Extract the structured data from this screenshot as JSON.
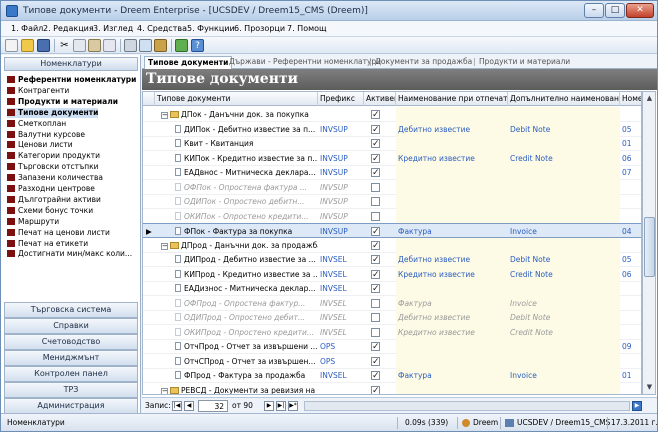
{
  "window": {
    "title": "Типове документи - Dreem Enterprise - [UCSDEV / Dreem15_CMS (Dreem)]"
  },
  "menu": [
    "1. Файл",
    "2. Редакция",
    "3. Изглед",
    "4. Средства",
    "5. Функции",
    "6. Прозорци",
    "7. Помощ"
  ],
  "sidebar": {
    "header": "Номенклатури",
    "items": [
      {
        "label": "Референтни номенклатури",
        "bold": true
      },
      {
        "label": "Контрагенти",
        "bold": false
      },
      {
        "label": "Продукти и материали",
        "bold": true
      },
      {
        "label": "Типове документи",
        "bold": true,
        "selected": true
      },
      {
        "label": "Сметкоплан",
        "bold": false
      },
      {
        "label": "Валутни курсове",
        "bold": false
      },
      {
        "label": "Ценови листи",
        "bold": false
      },
      {
        "label": "Категории продукти",
        "bold": false
      },
      {
        "label": "Търговски отстъпки",
        "bold": false
      },
      {
        "label": "Запазени количества",
        "bold": false
      },
      {
        "label": "Разходни центрове",
        "bold": false
      },
      {
        "label": "Дълготрайни активи",
        "bold": false
      },
      {
        "label": "Схеми бонус точки",
        "bold": false
      },
      {
        "label": "Маршрути",
        "bold": false
      },
      {
        "label": "Печат на ценови листи",
        "bold": false
      },
      {
        "label": "Печат на етикети",
        "bold": false
      },
      {
        "label": "Достигнати мин/макс коли...",
        "bold": false
      }
    ],
    "groups": [
      "Търговска система",
      "Справки",
      "Счетоводство",
      "Мениджмънт",
      "Контролен панел",
      "ТРЗ",
      "Администрация"
    ]
  },
  "tabs": [
    {
      "label": "Типове документи",
      "active": true
    },
    {
      "label": "Държави - Референтни номенклатури",
      "active": false
    },
    {
      "label": "Документи за продажба",
      "active": false
    },
    {
      "label": "Продукти и материали",
      "active": false
    }
  ],
  "page_title": "Типове документи",
  "grid": {
    "columns": [
      "Типове документи",
      "Префикс",
      "Активен",
      "Наименование при отпечат...",
      "Допълнително наименован...",
      "Номе"
    ],
    "rows": [
      {
        "level": 1,
        "type": "folder",
        "name": "ДПок - Данъчни док. за покупка",
        "prefix": "",
        "active": true,
        "print": "",
        "extra": "",
        "num": "",
        "dim": false
      },
      {
        "level": 2,
        "type": "doc",
        "name": "ДИПок - Дебитно известие за п...",
        "prefix": "INVSUP",
        "active": true,
        "print": "Дебитно известие",
        "extra": "Debit Note",
        "num": "05",
        "dim": false
      },
      {
        "level": 2,
        "type": "doc",
        "name": "Квит - Квитанция",
        "prefix": "",
        "active": true,
        "print": "",
        "extra": "",
        "num": "01",
        "dim": false
      },
      {
        "level": 2,
        "type": "doc",
        "name": "КИПок - Кредитно известие за п...",
        "prefix": "INVSUP",
        "active": true,
        "print": "Кредитно известие",
        "extra": "Credit Note",
        "num": "06",
        "dim": false
      },
      {
        "level": 2,
        "type": "doc",
        "name": "ЕАДвнос - Митническа деклара...",
        "prefix": "INVSUP",
        "active": true,
        "print": "",
        "extra": "",
        "num": "07",
        "dim": false
      },
      {
        "level": 2,
        "type": "doc",
        "name": "ОФПок - Опростена фактура ...",
        "prefix": "INVSUP",
        "active": false,
        "print": "",
        "extra": "",
        "num": "",
        "dim": true
      },
      {
        "level": 2,
        "type": "doc",
        "name": "ОДИПок - Опростено дебитн...",
        "prefix": "INVSUP",
        "active": false,
        "print": "",
        "extra": "",
        "num": "",
        "dim": true
      },
      {
        "level": 2,
        "type": "doc",
        "name": "ОКИПок - Опростено кредити...",
        "prefix": "INVSUP",
        "active": false,
        "print": "",
        "extra": "",
        "num": "",
        "dim": true
      },
      {
        "level": 2,
        "type": "doc",
        "name": "ФПок - Фактура за покупка",
        "prefix": "INVSUP",
        "active": true,
        "print": "Фактура",
        "extra": "Invoice",
        "num": "04",
        "dim": false,
        "selected": true
      },
      {
        "level": 1,
        "type": "folder",
        "name": "ДПрод - Данъчни док. за продажба",
        "prefix": "",
        "active": true,
        "print": "",
        "extra": "",
        "num": "",
        "dim": false
      },
      {
        "level": 2,
        "type": "doc",
        "name": "ДИПрод - Дебитно известие за ...",
        "prefix": "INVSEL",
        "active": true,
        "print": "Дебитно известие",
        "extra": "Debit Note",
        "num": "05",
        "dim": false
      },
      {
        "level": 2,
        "type": "doc",
        "name": "КИПрод - Кредитно известие за ...",
        "prefix": "INVSEL",
        "active": true,
        "print": "Кредитно известие",
        "extra": "Credit Note",
        "num": "06",
        "dim": false
      },
      {
        "level": 2,
        "type": "doc",
        "name": "ЕАДизнос - Митническа деклар...",
        "prefix": "INVSEL",
        "active": true,
        "print": "",
        "extra": "",
        "num": "",
        "dim": false
      },
      {
        "level": 2,
        "type": "doc",
        "name": "ОФПрод - Опростена фактур...",
        "prefix": "INVSEL",
        "active": false,
        "print": "Фактура",
        "extra": "Invoice",
        "num": "",
        "dim": true
      },
      {
        "level": 2,
        "type": "doc",
        "name": "ОДИПрод - Опростено дебит...",
        "prefix": "INVSEL",
        "active": false,
        "print": "Дебитно известие",
        "extra": "Debit Note",
        "num": "",
        "dim": true
      },
      {
        "level": 2,
        "type": "doc",
        "name": "ОКИПрод - Опростено кредити...",
        "prefix": "INVSEL",
        "active": false,
        "print": "Кредитно известие",
        "extra": "Credit Note",
        "num": "",
        "dim": true
      },
      {
        "level": 2,
        "type": "doc",
        "name": "ОтчПрод - Отчет за извършени ...",
        "prefix": "OPS",
        "active": true,
        "print": "",
        "extra": "",
        "num": "09",
        "dim": false
      },
      {
        "level": 2,
        "type": "doc",
        "name": "ОтчСПрод - Отчет за извършен...",
        "prefix": "OPS",
        "active": true,
        "print": "",
        "extra": "",
        "num": "",
        "dim": false
      },
      {
        "level": 2,
        "type": "doc",
        "name": "ФПрод - Фактура за продажба",
        "prefix": "INVSEL",
        "active": true,
        "print": "Фактура",
        "extra": "Invoice",
        "num": "01",
        "dim": false
      },
      {
        "level": 1,
        "type": "folder",
        "name": "РЕВСД - Документи за ревизия на с...",
        "prefix": "",
        "active": true,
        "print": "",
        "extra": "",
        "num": "",
        "dim": false
      }
    ]
  },
  "navigator": {
    "label": "Запис:",
    "current": "32",
    "of": "от 90"
  },
  "status": {
    "left": "Номенклатури",
    "timing": "0.09s (339)",
    "db": "Dreem",
    "conn": "UCSDEV / Dreem15_CMS",
    "date": "17.3.2011 г."
  },
  "colors": {
    "accent": "#2a5dc0",
    "title_bg": "#6b6b6b",
    "folder": "#e8c25a"
  }
}
